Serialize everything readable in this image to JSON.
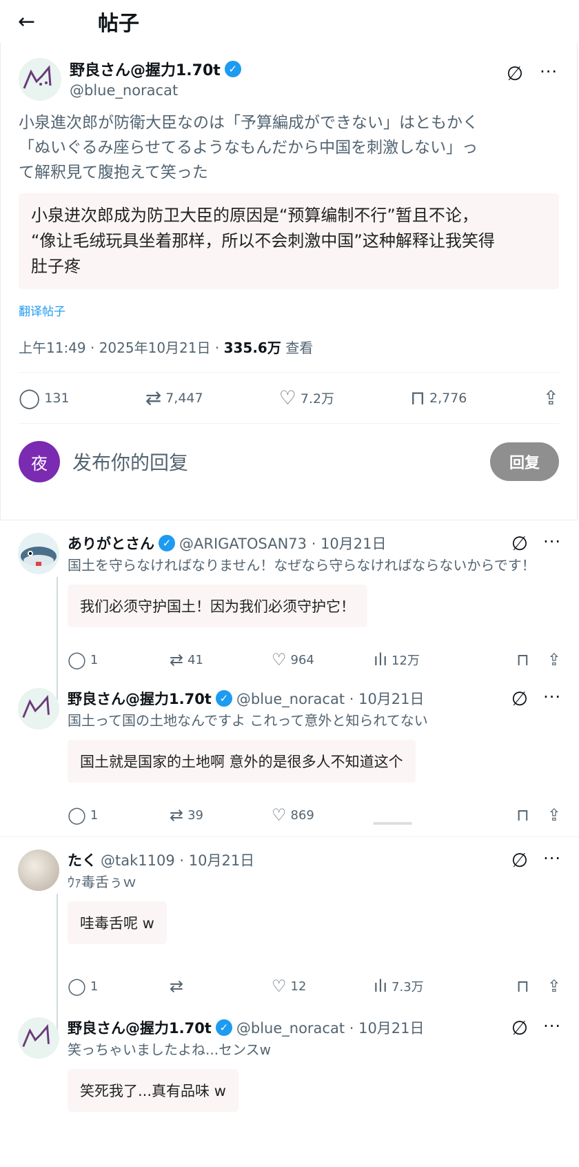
{
  "header": {
    "back_icon": "←",
    "title": "帖子"
  },
  "post": {
    "display_name": "野良さん@握力1.70t",
    "handle": "@blue_noracat",
    "text_lines": [
      "小泉進次郎が防衛大臣なのは「予算編成ができない」はともかく",
      "「ぬいぐるみ座らせてるようなもんだから中国を刺激しない」っ",
      "て解釈見て腹抱えて笑った"
    ],
    "translation_lines": [
      "小泉进次郎成为防卫大臣的原因是“预算编制不行”暂且不论，",
      "“像让毛绒玩具坐着那样，所以不会刺激中国”这种解释让我笑得",
      "肚子疼"
    ],
    "translate_link": "翻译帖子",
    "time": "上午11:49 · 2025年10月21日 · ",
    "views": "335.6万",
    "views_label": " 查看",
    "stats": {
      "replies": "131",
      "reposts": "7,447",
      "likes": "7.2万",
      "bookmarks": "2,776"
    }
  },
  "composer": {
    "avatar_letter": "夜",
    "placeholder": "发布你的回复",
    "button": "回复"
  },
  "replies": [
    {
      "name": "ありがとさん",
      "handle": "@ARIGATOSAN73 · 10月21日",
      "text": "国土を守らなければなりません！なぜなら守らなければならないからです！",
      "translation": "我们必须守护国土！因为我们必须守护它！",
      "replies": "1",
      "reposts": "41",
      "likes": "964",
      "views": "12万"
    },
    {
      "name": "野良さん@握力1.70t",
      "handle": "@blue_noracat · 10月21日",
      "text": "国土って国の土地なんですよ  これって意外と知られてない",
      "translation": "国土就是国家的土地啊  意外的是很多人不知道这个",
      "replies": "1",
      "reposts": "39",
      "likes": "869",
      "views": ""
    },
    {
      "name": "たく",
      "handle": "@tak1109 · 10月21日",
      "text": "ｳｧ毒舌ぅｗ",
      "translation": "哇毒舌呢 w",
      "replies": "1",
      "reposts": "",
      "likes": "12",
      "views": "7.3万"
    },
    {
      "name": "野良さん@握力1.70t",
      "handle": "@blue_noracat · 10月21日",
      "text": "笑っちゃいましたよね...センスw",
      "translation": "笑死我了...真有品味 w"
    }
  ],
  "colors": {
    "accent": "#1d9bf0",
    "muted": "#536471",
    "translation_bg": "#fbf5f5",
    "composer_avatar": "#7b2ab2"
  }
}
